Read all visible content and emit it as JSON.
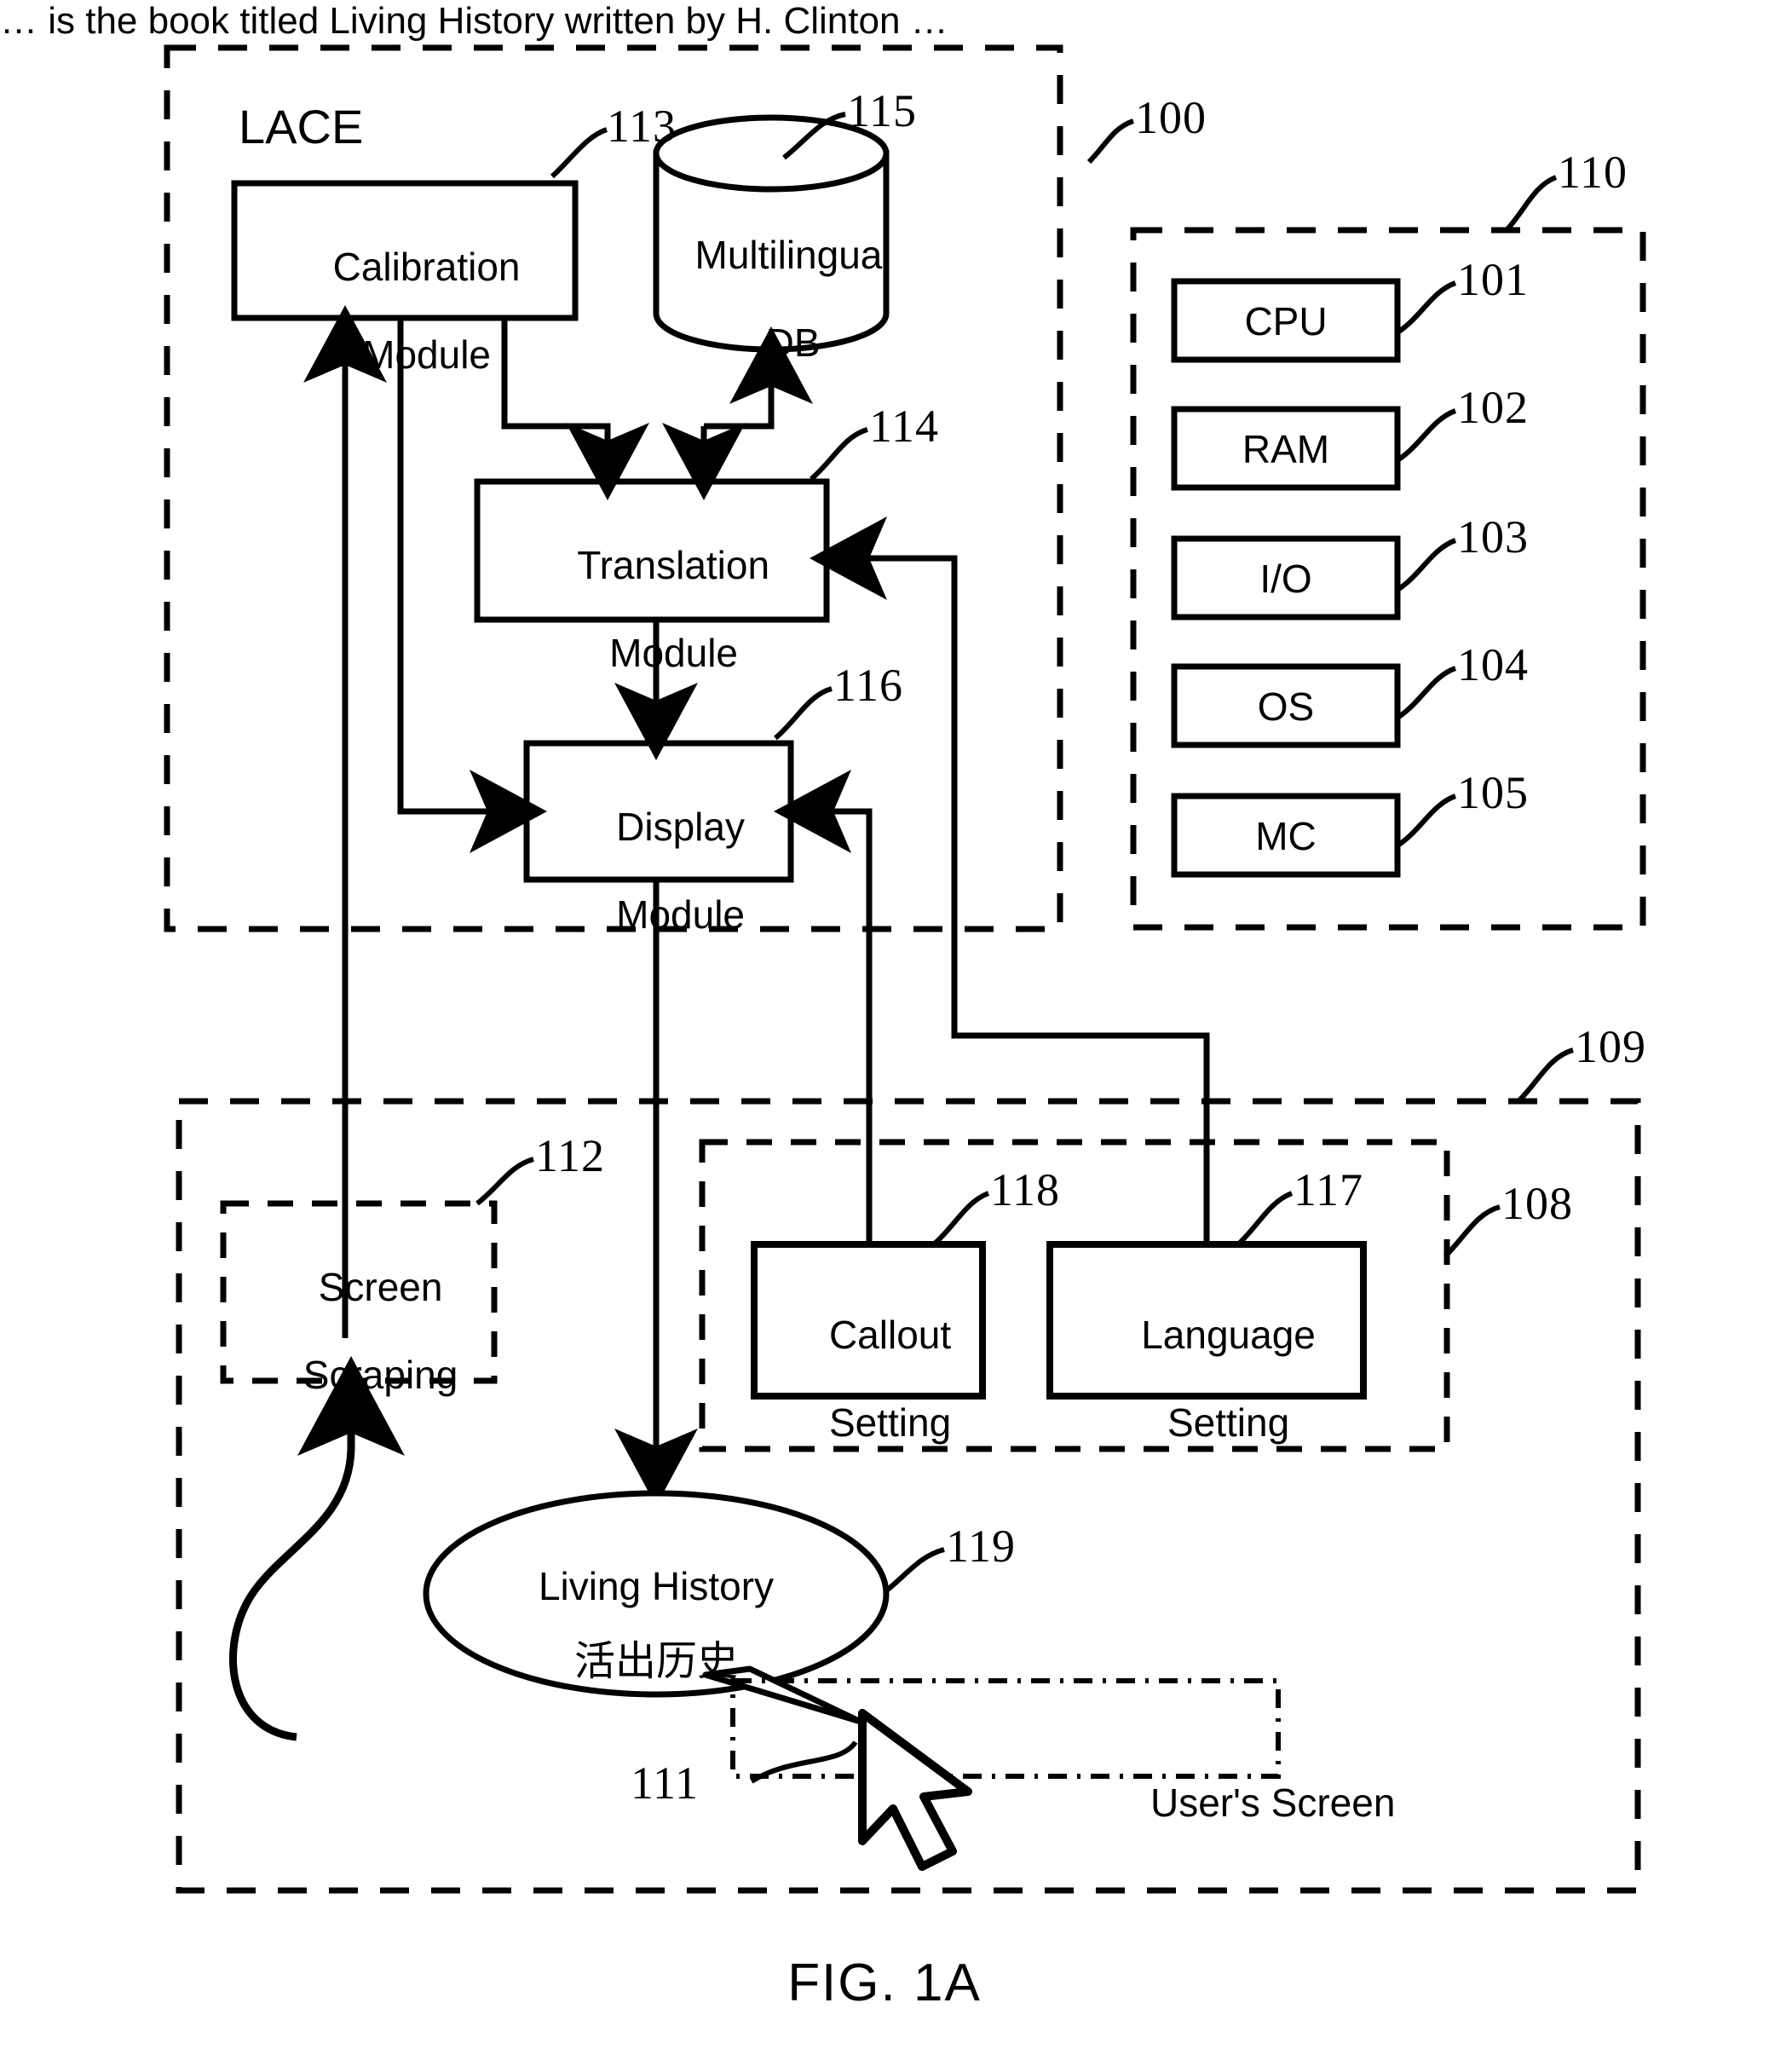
{
  "figure": {
    "caption": "FIG. 1A"
  },
  "system": {
    "ref": "100"
  },
  "lace": {
    "title": "LACE",
    "ref_calibration": "113",
    "ref_db": "115",
    "ref_translation": "114",
    "ref_display": "116",
    "modules": [
      {
        "id": "calibration",
        "label_line1": "Calibration",
        "label_line2": "Module",
        "ref": "113"
      },
      {
        "id": "multilingual-db",
        "label_line1": "Multilingual",
        "label_line2": "DB",
        "ref": "115"
      },
      {
        "id": "translation",
        "label_line1": "Translation",
        "label_line2": "Module",
        "ref": "114"
      },
      {
        "id": "display",
        "label_line1": "Display",
        "label_line2": "Module",
        "ref": "116"
      }
    ]
  },
  "hardware": {
    "ref": "110",
    "components": [
      {
        "label": "CPU",
        "ref": "101"
      },
      {
        "label": "RAM",
        "ref": "102"
      },
      {
        "label": "I/O",
        "ref": "103"
      },
      {
        "label": "OS",
        "ref": "104"
      },
      {
        "label": "MC",
        "ref": "105"
      }
    ]
  },
  "user_screen": {
    "ref": "109",
    "label": "User's Screen",
    "screen_scraping": {
      "label_line1": "Screen",
      "label_line2": "Scraping",
      "ref": "112"
    },
    "settings_panel": {
      "ref": "108",
      "items": [
        {
          "label_line1": "Callout",
          "label_line2": "Setting",
          "ref": "118"
        },
        {
          "label_line1": "Language",
          "label_line2": "Setting",
          "ref": "117"
        }
      ]
    },
    "callout_bubble": {
      "line1": "Living History",
      "line2": "活出历史",
      "ref": "119"
    },
    "body_text": "… is the book titled Living History written by H. Clinton …",
    "cursor_ref": "111",
    "highlighted_phrase": "Living History"
  },
  "colors": {
    "ink": "#000000",
    "paper": "#ffffff"
  }
}
